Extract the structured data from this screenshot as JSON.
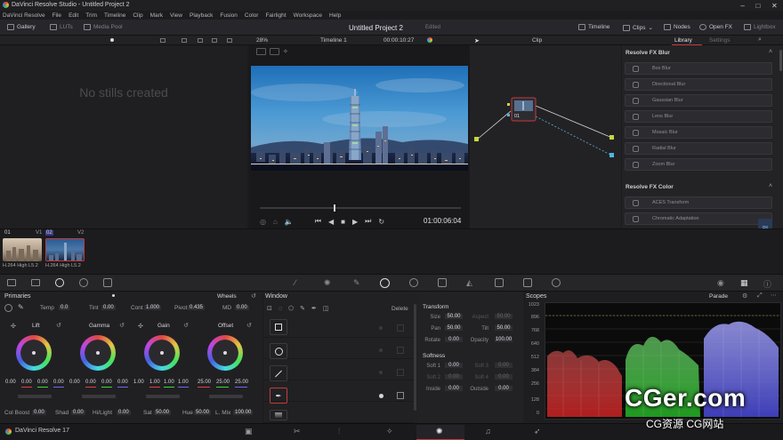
{
  "window": {
    "title": "DaVinci Resolve Studio - Untitled Project 2"
  },
  "menu": [
    "DaVinci Resolve",
    "File",
    "Edit",
    "Trim",
    "Timeline",
    "Clip",
    "Mark",
    "View",
    "Playback",
    "Fusion",
    "Color",
    "Fairlight",
    "Workspace",
    "Help"
  ],
  "toolbar": {
    "gallery": "Gallery",
    "luts": "LUTs",
    "media_pool": "Media Pool",
    "project_title": "Untitled Project 2",
    "edited": "Edited",
    "timeline": "Timeline",
    "clips": "Clips",
    "nodes": "Nodes",
    "open_fx": "Open FX",
    "lightbox": "Lightbox"
  },
  "subtool": {
    "zoom": "28%",
    "timeline_name": "Timeline 1",
    "timecode": "00:00:10:27",
    "clip_mode": "Clip",
    "library_tab": "Library",
    "settings_tab": "Settings"
  },
  "gallery": {
    "empty_text": "No stills created"
  },
  "viewer": {
    "timecode": "01:00:06:04",
    "playhead_fraction": 0.37
  },
  "node": {
    "label": "01"
  },
  "library": {
    "blur_header": "Resolve FX Blur",
    "blur_items": [
      "Box Blur",
      "Directional Blur",
      "Gaussian Blur",
      "Lens Blur",
      "Mosaic Blur",
      "Radial Blur",
      "Zoom Blur"
    ],
    "color_header": "Resolve FX Color",
    "color_items": [
      "ACES Transform",
      "Chromatic Adaptation"
    ]
  },
  "clips": [
    {
      "num": "01",
      "track": "V1",
      "codec": "H.264 High L5.2"
    },
    {
      "num": "02",
      "track": "V2",
      "codec": "H.264 High L5.2"
    }
  ],
  "primaries": {
    "title": "Primaries",
    "mode": "Wheels",
    "temp_label": "Temp",
    "temp": "0.0",
    "tint_label": "Tint",
    "tint": "0.00",
    "cont_label": "Cont",
    "cont": "1.000",
    "pivot_label": "Pivot",
    "pivot": "0.435",
    "md_label": "MD",
    "md": "0.00",
    "wheels": [
      {
        "name": "Lift",
        "values": [
          "0.00",
          "0.00",
          "0.00",
          "0.00"
        ]
      },
      {
        "name": "Gamma",
        "values": [
          "0.00",
          "0.00",
          "0.00",
          "0.00"
        ]
      },
      {
        "name": "Gain",
        "values": [
          "1.00",
          "1.00",
          "1.00",
          "1.00"
        ]
      },
      {
        "name": "Offset",
        "values": [
          "25.00",
          "25.00",
          "25.00"
        ]
      }
    ],
    "col_boost_label": "Col Boost",
    "col_boost": "0.00",
    "shad_label": "Shad",
    "shad": "0.00",
    "hilight_label": "Hi/Light",
    "hilight": "0.00",
    "sat_label": "Sat",
    "sat": "50.00",
    "hue_label": "Hue",
    "hue": "50.00",
    "lmix_label": "L. Mix",
    "lmix": "100.00"
  },
  "window_panel": {
    "title": "Window",
    "delete": "Delete"
  },
  "transform": {
    "title": "Transform",
    "size_label": "Size",
    "size": "50.00",
    "aspect_label": "Aspect",
    "aspect": "50.00",
    "pan_label": "Pan",
    "pan": "50.00",
    "tilt_label": "Tilt",
    "tilt": "50.00",
    "rotate_label": "Rotate",
    "rotate": "0.00",
    "opacity_label": "Opacity",
    "opacity": "100.00",
    "softness_title": "Softness",
    "soft1_label": "Soft 1",
    "soft1": "0.00",
    "soft3_label": "Soft 3",
    "soft3": "0.00",
    "soft2_label": "Soft 2",
    "soft2": "0.00",
    "soft4_label": "Soft 4",
    "soft4": "0.00",
    "inside_label": "Inside",
    "inside": "0.00",
    "outside_label": "Outside",
    "outside": "0.00"
  },
  "scopes": {
    "title": "Scopes",
    "mode": "Parade",
    "ticks": [
      "1023",
      "896",
      "768",
      "640",
      "512",
      "384",
      "256",
      "128",
      "0"
    ]
  },
  "bottom": {
    "app_name": "DaVinci Resolve 17"
  },
  "watermark": {
    "line1": "CGer.com",
    "line2": "CG资源 CG网站"
  },
  "colors": {
    "accent": "#c23b3b",
    "scope_red": "#e04040",
    "scope_green": "#3ad83a",
    "scope_blue": "#6a6af0"
  }
}
